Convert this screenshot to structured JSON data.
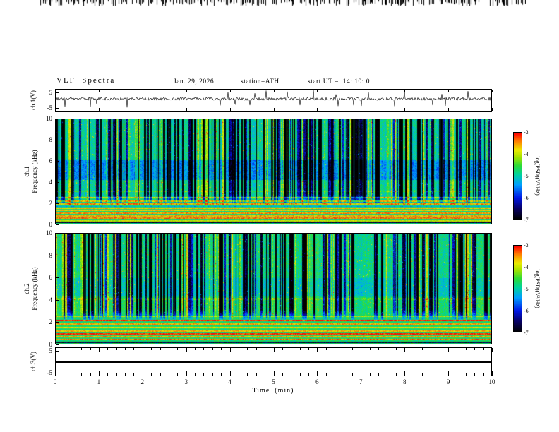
{
  "header": {
    "title": "VLF  Spectra",
    "date": "Jan. 29, 2026",
    "station": "station=ATH",
    "start_ut": "start UT =  14: 10: 0"
  },
  "xaxis": {
    "label": "Time  (min)",
    "ticks": [
      "0",
      "1",
      "2",
      "3",
      "4",
      "5",
      "6",
      "7",
      "8",
      "9",
      "10"
    ]
  },
  "panels": {
    "waveform": {
      "label": "ch.1(V)",
      "yticks": [
        "5",
        "-5"
      ]
    },
    "spec1": {
      "channel": "ch.1",
      "ylabel": "Frequency  (kHz)",
      "yticks": [
        "10",
        "8",
        "6",
        "4",
        "2",
        "0"
      ]
    },
    "spec2": {
      "channel": "ch.2",
      "ylabel": "Frequency  (kHz)",
      "yticks": [
        "10",
        "8",
        "6",
        "4",
        "2",
        "0"
      ]
    },
    "ch3": {
      "label": "ch.3(V)",
      "yticks": [
        "5",
        "-5"
      ]
    }
  },
  "colorbar": {
    "label": "log(PSD)(V²/Hz)",
    "ticks": [
      "-3",
      "-4",
      "-5",
      "-6",
      "-7"
    ]
  },
  "colors": {
    "background": "#ffffff",
    "axis": "#000000"
  },
  "colormap": {
    "stops": [
      [
        0.0,
        0,
        0,
        0
      ],
      [
        0.12,
        8,
        0,
        96
      ],
      [
        0.25,
        0,
        24,
        232
      ],
      [
        0.4,
        0,
        160,
        255
      ],
      [
        0.52,
        0,
        212,
        156
      ],
      [
        0.62,
        44,
        220,
        56
      ],
      [
        0.72,
        164,
        228,
        0
      ],
      [
        0.8,
        236,
        236,
        0
      ],
      [
        0.9,
        255,
        132,
        0
      ],
      [
        1.0,
        255,
        0,
        0
      ]
    ]
  },
  "waveform_sim": {
    "seed": 77,
    "noise": 4,
    "spike_prob": 0.035,
    "spike_min": 6,
    "spike_max": 13
  },
  "spectrograms": {
    "spec1": {
      "seed": 1234,
      "base": 0.52,
      "streak_prob": 0.3,
      "streak_fade": [
        1.6,
        3.0
      ],
      "dark_band": [
        4.2,
        6.2,
        -0.13
      ],
      "low_boost": [
        0,
        2.6,
        0.04
      ],
      "lines": [
        {
          "f": 3.15,
          "a": 0.1,
          "w": 0.08
        },
        {
          "f": 2.55,
          "a": 0.22,
          "w": 0.07
        },
        {
          "f": 2.2,
          "a": 0.3,
          "w": 0.07
        },
        {
          "f": 1.9,
          "a": 0.34,
          "w": 0.07
        },
        {
          "f": 1.7,
          "a": -0.12,
          "w": 0.04
        },
        {
          "f": 1.55,
          "a": 0.28,
          "w": 0.07
        },
        {
          "f": 1.3,
          "a": 0.26,
          "w": 0.06
        },
        {
          "f": 1.05,
          "a": 0.32,
          "w": 0.06
        },
        {
          "f": 0.8,
          "a": 0.3,
          "w": 0.06
        },
        {
          "f": 0.55,
          "a": 0.34,
          "w": 0.06
        },
        {
          "f": 0.3,
          "a": 0.2,
          "w": 0.05
        },
        {
          "f": 0.15,
          "a": -0.5,
          "w": 0.08
        }
      ]
    },
    "spec2": {
      "seed": 5678,
      "base": 0.54,
      "streak_prob": 0.28,
      "streak_fade": [
        2.0,
        3.2
      ],
      "dark_band": [
        4.3,
        6.0,
        -0.06
      ],
      "low_boost": [
        0,
        4.0,
        0.03
      ],
      "lines": [
        {
          "f": 4.1,
          "a": 0.1,
          "w": 0.08
        },
        {
          "f": 2.5,
          "a": 0.2,
          "w": 0.06
        },
        {
          "f": 2.15,
          "a": 0.42,
          "w": 0.08
        },
        {
          "f": 1.8,
          "a": 0.3,
          "w": 0.06
        },
        {
          "f": 1.5,
          "a": 0.24,
          "w": 0.06
        },
        {
          "f": 1.2,
          "a": 0.28,
          "w": 0.06
        },
        {
          "f": 0.95,
          "a": 0.4,
          "w": 0.07
        },
        {
          "f": 0.7,
          "a": 0.3,
          "w": 0.06
        },
        {
          "f": 0.45,
          "a": 0.34,
          "w": 0.06
        },
        {
          "f": 0.15,
          "a": -0.5,
          "w": 0.08
        }
      ]
    }
  },
  "top_strip": {
    "note": "clipped black trace remnants visible along the very top edge of the image"
  },
  "chart_data": [
    {
      "type": "line",
      "panel": "top",
      "title": "ch.1(V) waveform",
      "xlabel": "Time (min)",
      "ylabel": "ch.1(V)",
      "xlim": [
        0,
        10
      ],
      "ylim": [
        -5,
        5
      ],
      "yticks": [
        5,
        -5
      ],
      "series_description": "Broadband noisy voltage trace hugging 0 V with many impulsive spikes (sferics) reaching toward ±5 V, roughly uniform across the 10-minute record."
    },
    {
      "type": "heatmap",
      "panel": "second",
      "title": "ch.1 VLF spectrogram",
      "xlabel": "Time (min)",
      "ylabel": "Frequency (kHz)",
      "xlim": [
        0,
        10
      ],
      "ylim": [
        0,
        10
      ],
      "yticks": [
        0,
        2,
        4,
        6,
        8,
        10
      ],
      "zlabel": "log(PSD)(V²/Hz)",
      "zlim": [
        -7,
        -3
      ],
      "features": [
        "green/cyan background near log PSD ≈ -5",
        "dense vertical dark-blue striations above ~2 kHz from impulsive sferics",
        "darker blue suppression band between ~4 and 6 kHz",
        "bright yellow-to-red horizontal harmonic lines below ~2.5 kHz",
        "near-black line at the bottom edge (0 kHz)"
      ]
    },
    {
      "type": "heatmap",
      "panel": "third",
      "title": "ch.2 VLF spectrogram",
      "xlabel": "Time (min)",
      "ylabel": "Frequency (kHz)",
      "xlim": [
        0,
        10
      ],
      "ylim": [
        0,
        10
      ],
      "yticks": [
        0,
        2,
        4,
        6,
        8,
        10
      ],
      "zlabel": "log(PSD)(V²/Hz)",
      "zlim": [
        -7,
        -3
      ],
      "features": [
        "similar vertical streaked structure above ~2 kHz",
        "more uniform green/cyan background below ~4 kHz",
        "strong yellow horizontal lines near 0.5-2.2 kHz",
        "near-black line at the bottom edge (0 kHz)"
      ]
    },
    {
      "type": "line",
      "panel": "bottom",
      "title": "ch.3(V) waveform",
      "xlabel": "Time (min)",
      "ylabel": "ch.3(V)",
      "xlim": [
        0,
        10
      ],
      "ylim": [
        -5,
        5
      ],
      "yticks": [
        5,
        -5
      ],
      "series_description": "Constant flat line at 0 V for the entire record (channel inactive)."
    }
  ]
}
